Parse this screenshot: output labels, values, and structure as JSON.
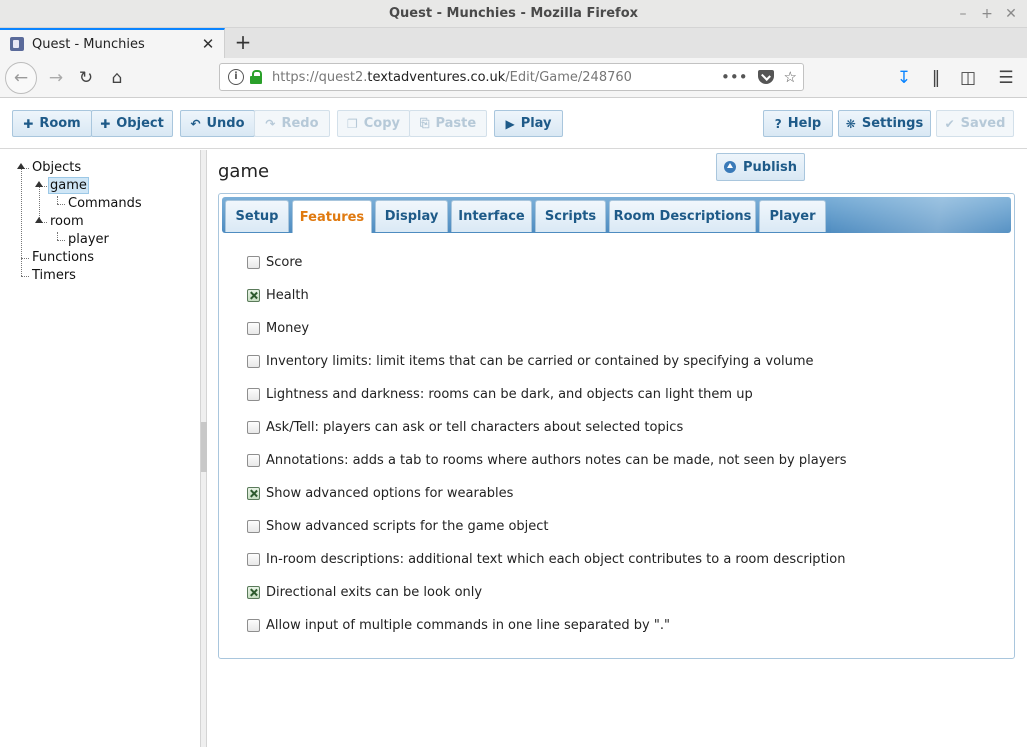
{
  "window": {
    "title": "Quest - Munchies - Mozilla Firefox"
  },
  "browser": {
    "tab_title": "Quest - Munchies",
    "url_prefix": "https://quest2.",
    "url_domain": "textadventures.co.uk",
    "url_path": "/Edit/Game/248760",
    "url_full": "https://quest2.textadventures.co.uk/Edit/Game/248760"
  },
  "toolbar": {
    "room": "Room",
    "object": "Object",
    "undo": "Undo",
    "redo": "Redo",
    "copy": "Copy",
    "paste": "Paste",
    "play": "Play",
    "help": "Help",
    "settings": "Settings",
    "saved": "Saved"
  },
  "tree": {
    "objects": "Objects",
    "game": "game",
    "commands": "Commands",
    "room": "room",
    "player": "player",
    "functions": "Functions",
    "timers": "Timers"
  },
  "page": {
    "title": "game",
    "publish": "Publish"
  },
  "tabs": [
    "Setup",
    "Features",
    "Display",
    "Interface",
    "Scripts",
    "Room Descriptions",
    "Player"
  ],
  "active_tab": "Features",
  "features": [
    {
      "label": "Score",
      "checked": false
    },
    {
      "label": "Health",
      "checked": true
    },
    {
      "label": "Money",
      "checked": false
    },
    {
      "label": "Inventory limits: limit items that can be carried or contained by specifying a volume",
      "checked": false
    },
    {
      "label": "Lightness and darkness: rooms can be dark, and objects can light them up",
      "checked": false
    },
    {
      "label": "Ask/Tell: players can ask or tell characters about selected topics",
      "checked": false
    },
    {
      "label": "Annotations: adds a tab to rooms where authors notes can be made, not seen by players",
      "checked": false
    },
    {
      "label": "Show advanced options for wearables",
      "checked": true
    },
    {
      "label": "Show advanced scripts for the game object",
      "checked": false
    },
    {
      "label": "In-room descriptions: additional text which each object contributes to a room description",
      "checked": false
    },
    {
      "label": "Directional exits can be look only",
      "checked": true
    },
    {
      "label": "Allow input of multiple commands in one line separated by \".\"",
      "checked": false
    }
  ]
}
